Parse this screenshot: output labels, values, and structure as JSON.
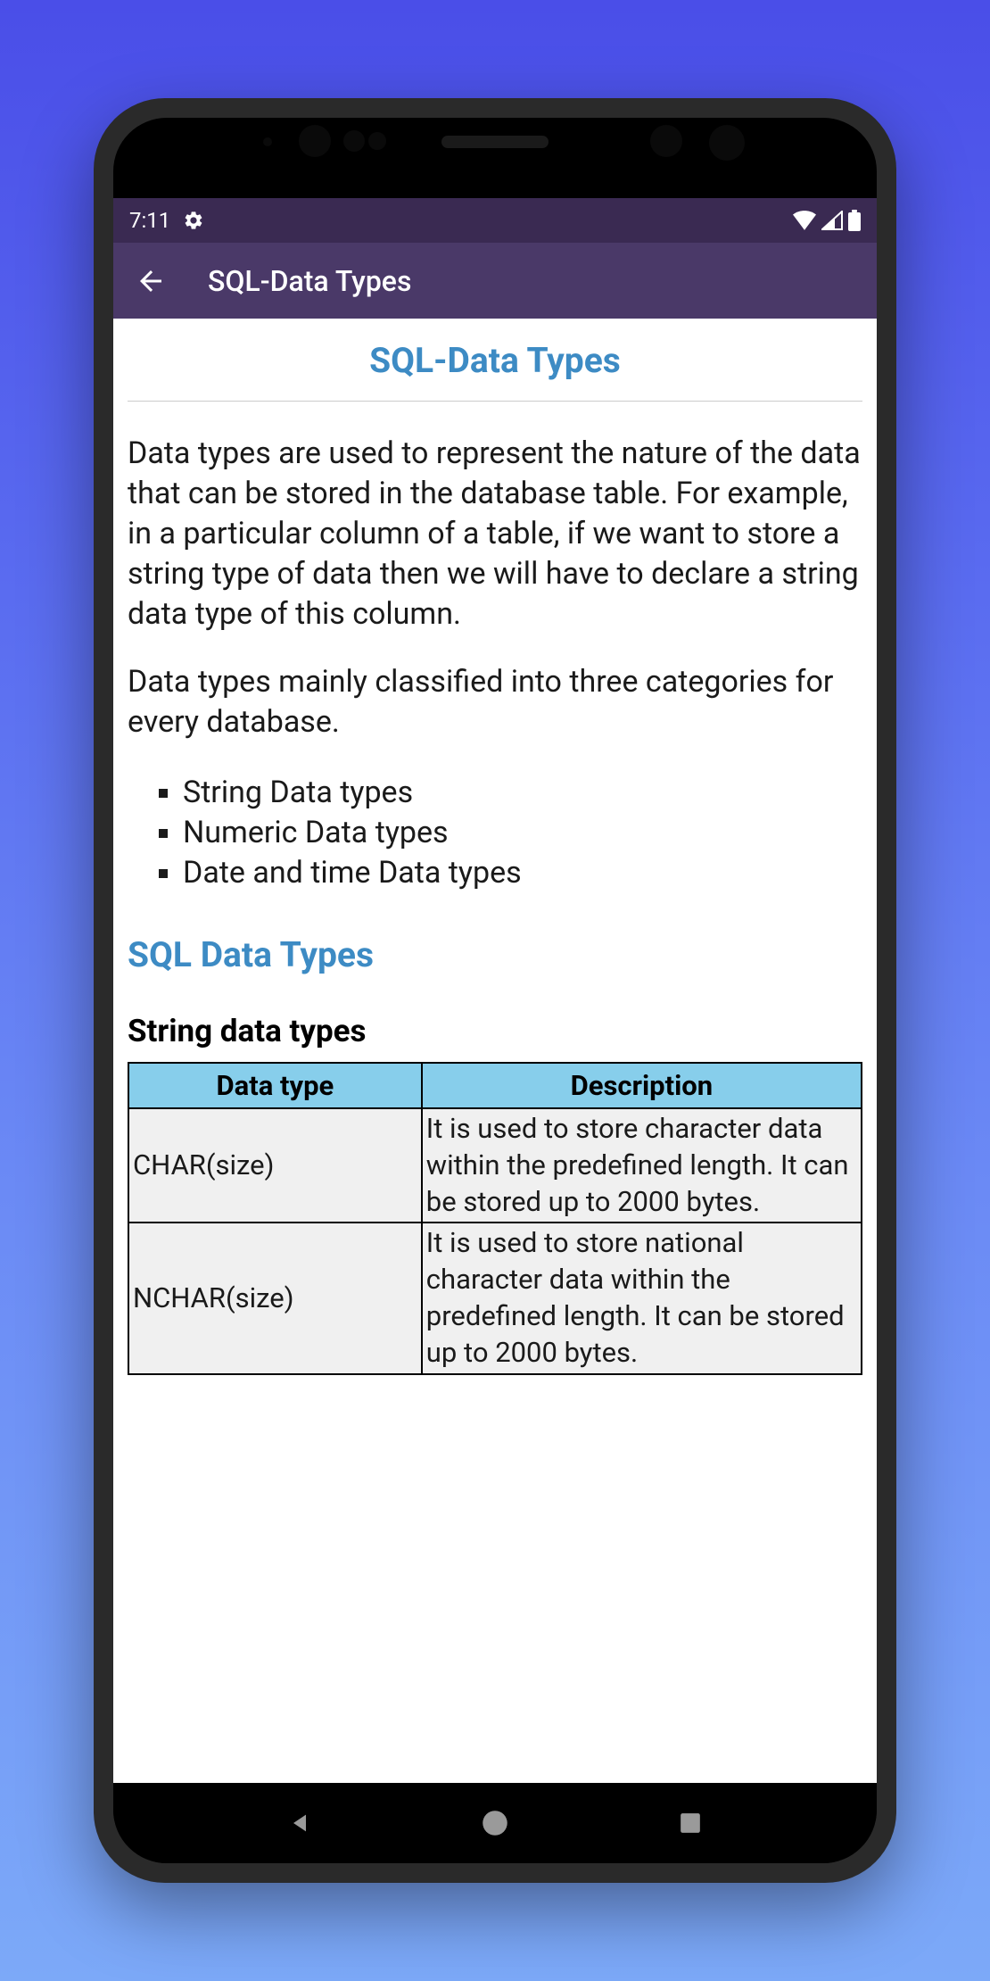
{
  "status_bar": {
    "time": "7:11"
  },
  "app_bar": {
    "title": "SQL-Data Types"
  },
  "content": {
    "page_title": "SQL-Data Types",
    "para1": "Data types are used to represent the nature of the data that can be stored in the database table. For example, in a particular column of a table, if we want to store a string type of data then we will have to declare a string data type of this column.",
    "para2": "Data types mainly classified into three categories for every database.",
    "bullets": [
      "String Data types",
      "Numeric Data types",
      "Date and time Data types"
    ],
    "section_heading": "SQL Data Types",
    "sub_heading": "String data types",
    "table": {
      "headers": [
        "Data type",
        "Description"
      ],
      "rows": [
        {
          "type": "CHAR(size)",
          "desc": "It is used to store character data within the predefined length. It can be stored up to 2000 bytes."
        },
        {
          "type": "NCHAR(size)",
          "desc": "It is used to store national character data within the predefined length. It can be stored up to 2000 bytes."
        }
      ]
    }
  }
}
